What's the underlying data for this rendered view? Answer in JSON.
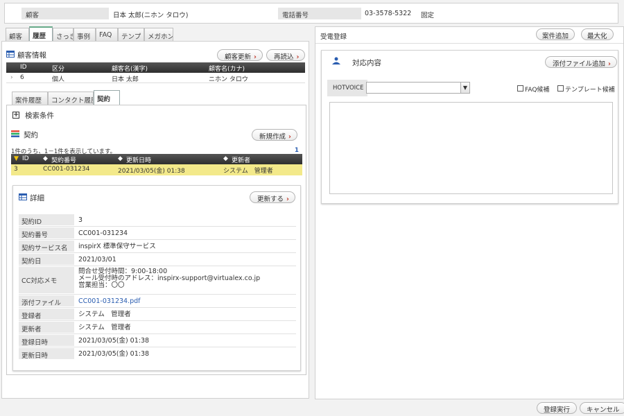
{
  "customer_bar": {
    "customer_label": "顧客",
    "customer_value": "日本 太郎(ニホン タロウ)",
    "phone_label": "電話番号",
    "phone_value": "03-3578-5322",
    "phone_type": "固定"
  },
  "left_tabs": [
    "顧客",
    "履歴",
    "さっきの",
    "事例",
    "FAQ",
    "テンプ",
    "メガホン"
  ],
  "left_tabs_active": "履歴",
  "customer_info": {
    "title": "顧客情報",
    "update_button": "顧客更新",
    "reload_button": "再読込",
    "columns": [
      "ID",
      "区分",
      "顧客名(漢字)",
      "顧客名(カナ)"
    ],
    "row": {
      "id": "6",
      "kubun": "個人",
      "name_kanji": "日本 太郎",
      "name_kana": "ニホン タロウ"
    }
  },
  "sub_tabs": [
    "案件履歴",
    "コンタクト履歴",
    "契約"
  ],
  "sub_tabs_active": "契約",
  "search": {
    "toggle": "+",
    "label": "検索条件"
  },
  "contract": {
    "title": "契約",
    "new_button": "新規作成",
    "count_text": "1件のうち、1－1件を表示しています。",
    "page": "1",
    "columns": [
      "ID",
      "契約番号",
      "更新日時",
      "更新者"
    ],
    "row": {
      "id": "3",
      "number": "CC001-031234",
      "updated_at": "2021/03/05(金) 01:38",
      "updated_by": "システム　管理者"
    }
  },
  "detail": {
    "title": "詳細",
    "update_button": "更新する",
    "rows": [
      {
        "label": "契約ID",
        "value": "3"
      },
      {
        "label": "契約番号",
        "value": "CC001-031234"
      },
      {
        "label": "契約サービス名",
        "value": "inspirX 標準保守サービス"
      },
      {
        "label": "契約日",
        "value": "2021/03/01"
      },
      {
        "label": "CC対応メモ",
        "value_lines": [
          "問合せ受付時間：9:00-18:00",
          "メール受付時のアドレス：inspirx-support@virtualex.co.jp",
          "営業担当：〇〇"
        ]
      },
      {
        "label": "添付ファイル",
        "value": "CC001-031234.pdf"
      },
      {
        "label": "登録者",
        "value": "システム　管理者"
      },
      {
        "label": "更新者",
        "value": "システム　管理者"
      },
      {
        "label": "登録日時",
        "value": "2021/03/05(金) 01:38"
      },
      {
        "label": "更新日時",
        "value": "2021/03/05(金) 01:38"
      }
    ]
  },
  "right_panel": {
    "title": "受電登録",
    "add_case_button": "案件追加",
    "maximize_button": "最大化",
    "response_title": "対応内容",
    "attach_button": "添付ファイル追加",
    "hotvoice_label": "HOTVOICE",
    "hotvoice_value": "",
    "faq_candidate": "FAQ候補",
    "template_candidate": "テンプレート候補",
    "textarea_value": ""
  },
  "footer": {
    "register_button": "登録実行",
    "cancel_button": "キャンセル"
  },
  "colors": {
    "selected_row": "#f3e98a",
    "link": "#2a5db0",
    "accent_red": "#c0392b"
  }
}
